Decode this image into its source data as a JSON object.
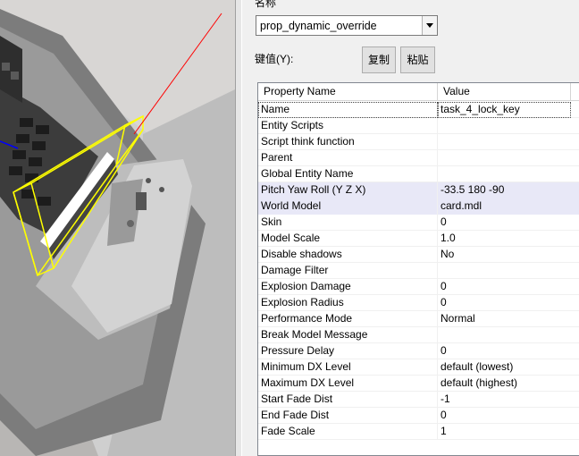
{
  "classname": {
    "label": "名称",
    "value": "prop_dynamic_override"
  },
  "keyvalues": {
    "label": "键值(Y):",
    "copy_button": "复制",
    "paste_button": "粘贴"
  },
  "grid": {
    "columns": [
      "Property Name",
      "Value"
    ],
    "rows": [
      {
        "name": "Name",
        "value": "task_4_lock_key"
      },
      {
        "name": "Entity Scripts",
        "value": ""
      },
      {
        "name": "Script think function",
        "value": ""
      },
      {
        "name": "Parent",
        "value": ""
      },
      {
        "name": "Global Entity Name",
        "value": ""
      },
      {
        "name": "Pitch Yaw Roll (Y Z X)",
        "value": "-33.5 180 -90"
      },
      {
        "name": "World Model",
        "value": "card.mdl"
      },
      {
        "name": "Skin",
        "value": "0"
      },
      {
        "name": "Model Scale",
        "value": "1.0"
      },
      {
        "name": "Disable shadows",
        "value": "No"
      },
      {
        "name": "Damage Filter",
        "value": ""
      },
      {
        "name": "Explosion Damage",
        "value": "0"
      },
      {
        "name": "Explosion Radius",
        "value": "0"
      },
      {
        "name": "Performance Mode",
        "value": "Normal"
      },
      {
        "name": "Break Model Message",
        "value": ""
      },
      {
        "name": "Pressure Delay",
        "value": "0"
      },
      {
        "name": "Minimum DX Level",
        "value": "default (lowest)"
      },
      {
        "name": "Maximum DX Level",
        "value": "default (highest)"
      },
      {
        "name": "Start Fade Dist",
        "value": "-1"
      },
      {
        "name": "End Fade Dist",
        "value": "0"
      },
      {
        "name": "Fade Scale",
        "value": "1"
      }
    ]
  },
  "colors": {
    "highlight_row": "#e8e8f7",
    "bbox_yellow": "#ffff00",
    "axis_red": "#ff0000"
  }
}
